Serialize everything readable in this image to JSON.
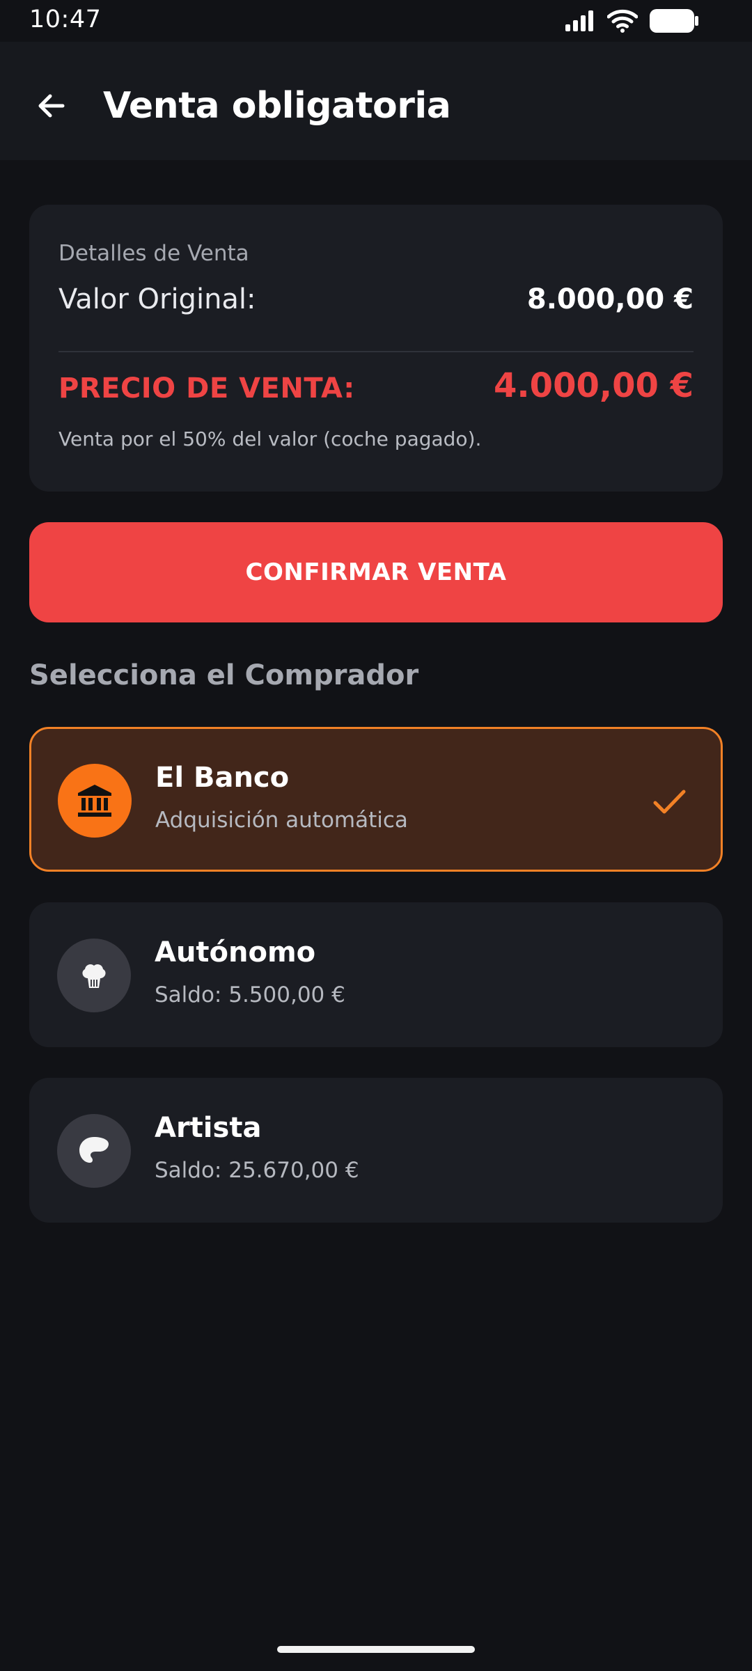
{
  "status_bar": {
    "time": "10:47"
  },
  "header": {
    "title": "Venta obligatoria",
    "back_icon": "arrow-left-icon"
  },
  "sale_details": {
    "heading": "Detalles de Venta",
    "original_label": "Valor Original:",
    "original_value": "8.000,00 €",
    "sale_price_label": "PRECIO DE VENTA:",
    "sale_price_value": "4.000,00 €",
    "note": "Venta por el 50% del valor (coche pagado)."
  },
  "confirm_button": {
    "label": "CONFIRMAR VENTA"
  },
  "buyers": {
    "section_title": "Selecciona el Comprador",
    "items": [
      {
        "name": "El Banco",
        "subtitle": "Adquisición automática",
        "icon": "bank-icon",
        "selected": true
      },
      {
        "name": "Autónomo",
        "subtitle": "Saldo: 5.500,00 €",
        "icon": "chef-hat-icon",
        "selected": false
      },
      {
        "name": "Artista",
        "subtitle": "Saldo: 25.670,00 €",
        "icon": "palette-icon",
        "selected": false
      }
    ]
  },
  "colors": {
    "accent": "#ef4444",
    "selected_border": "#f28126",
    "selected_avatar": "#f97316",
    "background": "#111216",
    "card": "#1b1d23"
  }
}
